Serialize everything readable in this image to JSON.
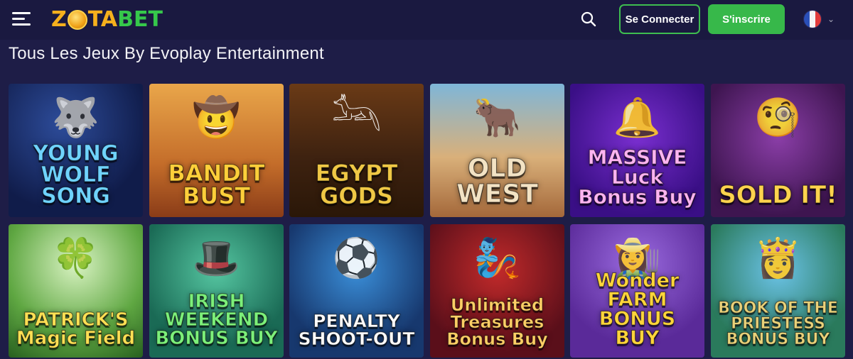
{
  "header": {
    "logo_z": "Z",
    "logo_ta": "TA",
    "logo_bet": "BET",
    "login_label": "Se Connecter",
    "signup_label": "S'inscrire",
    "language": "fr",
    "colors": {
      "accent_green": "#37b84a",
      "logo_gold": "#f6b01d",
      "bg": "#1a1940"
    }
  },
  "page": {
    "title": "Tous Les Jeux By Evoplay Entertainment"
  },
  "games": [
    {
      "title": "YOUNG WOLF SONG",
      "icon": "wolf-icon"
    },
    {
      "title": "BANDIT BUST",
      "icon": "cowboy-icon"
    },
    {
      "title": "EGYPT GODS",
      "icon": "anubis-icon"
    },
    {
      "title": "OLD WEST",
      "icon": "skull-horns-icon"
    },
    {
      "title": "MASSIVE Luck Bonus Buy",
      "icon": "bell-icon"
    },
    {
      "title": "SOLD IT!",
      "icon": "auctioneer-icon"
    },
    {
      "title": "PATRICK'S Magic Field",
      "icon": "pot-of-gold-icon"
    },
    {
      "title": "IRISH WEEKEND BONUS BUY",
      "icon": "leprechaun-icon"
    },
    {
      "title": "PENALTY SHOOT-OUT",
      "icon": "soccer-ball-icon"
    },
    {
      "title": "Unlimited Treasures Bonus Buy",
      "icon": "genie-icon"
    },
    {
      "title": "Wonder FARM BONUS BUY",
      "icon": "farmer-icon"
    },
    {
      "title": "BOOK OF THE PRIESTESS BONUS BUY",
      "icon": "priestess-icon"
    }
  ]
}
